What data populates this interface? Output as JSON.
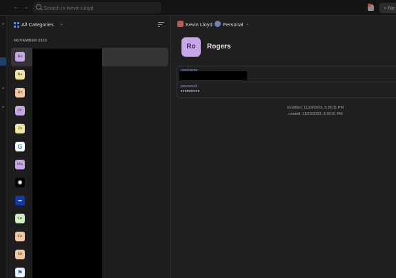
{
  "topbar": {
    "back_icon": "arrow-left-icon",
    "forward_icon": "arrow-right-icon",
    "search_placeholder": "Search in Kevin Lloyd",
    "new_item_label": "+ Ne"
  },
  "list": {
    "category_label": "All Categories",
    "section_header": "NOVEMBER 2023",
    "items": [
      {
        "initials": "Ro",
        "color": "#c6a8e8"
      },
      {
        "initials": "Re",
        "color": "#f2e6a4"
      },
      {
        "initials": "Ro",
        "color": "#f2c8a4"
      },
      {
        "initials": "Dr",
        "color": "#c6a8e8"
      },
      {
        "initials": "Zs",
        "color": "#f2e6a4"
      },
      {
        "initials": "",
        "color": "#ffffff",
        "icon": "google-icon"
      },
      {
        "initials": "Ma",
        "color": "#c6a8e8"
      },
      {
        "initials": "",
        "color": "#000000",
        "icon": "openai-icon"
      },
      {
        "initials": "",
        "color": "#0f3da8",
        "icon": "brand-blue-icon"
      },
      {
        "initials": "Le",
        "color": "#cfeec3"
      },
      {
        "initials": "Fo",
        "color": "#f2c8a4"
      },
      {
        "initials": "Mi",
        "color": "#f2c8a4"
      },
      {
        "initials": "",
        "color": "#e9f1fb",
        "icon": "brand-app-icon"
      }
    ]
  },
  "detail": {
    "owner": "Kevin Lloyd",
    "vault": "Personal",
    "item_initials": "Ro",
    "item_title": "Rogers",
    "fields": {
      "username_label": "username",
      "password_label": "password",
      "password_value": "••••••••••"
    },
    "modified": "modified: 11/23/2023, 3:38:31 PM",
    "created": "created: 11/23/2023, 3:38:31 PM"
  }
}
